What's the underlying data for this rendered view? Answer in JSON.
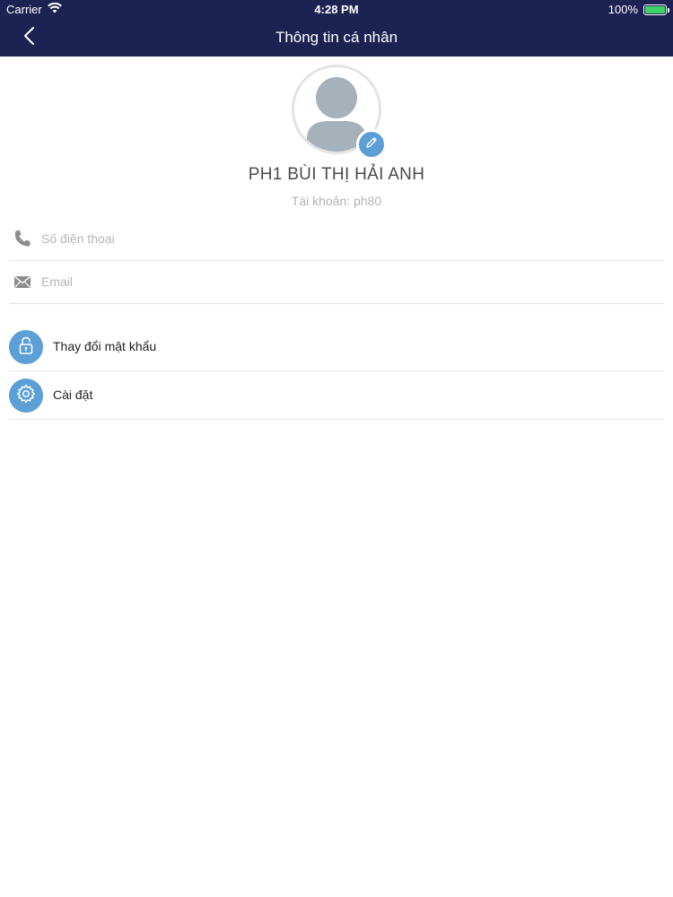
{
  "status_bar": {
    "carrier": "Carrier",
    "time": "4:28 PM",
    "battery": "100%",
    "battery_level": 1.0
  },
  "nav": {
    "title": "Thông tin cá nhân",
    "back_icon": "chevron-left-icon"
  },
  "profile": {
    "name": "PH1 BÙI THỊ HẢI ANH",
    "account": "Tài khoản: ph80",
    "avatar_icon": "avatar-placeholder-icon",
    "edit_icon": "pencil-icon"
  },
  "fields": {
    "phone": {
      "placeholder": "Số điện thoại",
      "value": "",
      "icon": "phone-icon"
    },
    "email": {
      "placeholder": "Email",
      "value": "",
      "icon": "envelope-icon"
    }
  },
  "menu": [
    {
      "label": "Thay đổi mật khẩu",
      "icon": "lock-icon"
    },
    {
      "label": "Cài đặt",
      "icon": "gear-icon"
    }
  ],
  "colors": {
    "header_bg": "#1c2353",
    "accent": "#5b9fd6",
    "battery": "#3ed36a"
  }
}
